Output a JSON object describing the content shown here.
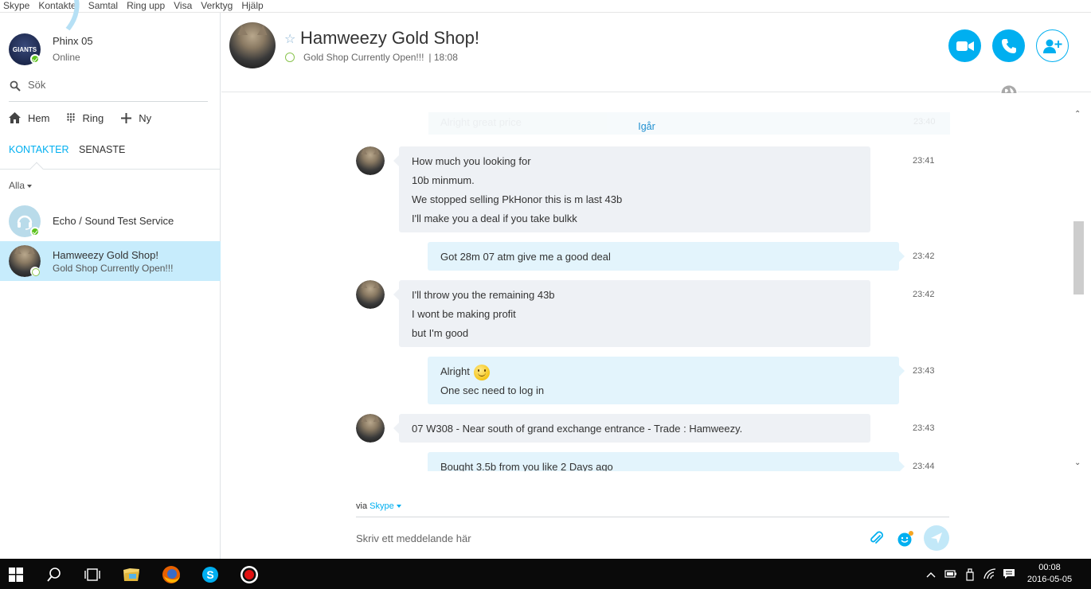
{
  "menu": [
    "Skype",
    "Kontakter",
    "Samtal",
    "Ring upp",
    "Visa",
    "Verktyg",
    "Hjälp"
  ],
  "me": {
    "name": "Phinx 05",
    "status": "Online",
    "avatar_text": "GIANTS"
  },
  "search": {
    "placeholder": "Sök"
  },
  "nav": {
    "home": "Hem",
    "call": "Ring",
    "new": "Ny"
  },
  "tabs": {
    "contacts": "KONTAKTER",
    "recent": "SENASTE"
  },
  "filter": "Alla",
  "contacts": [
    {
      "name": "Echo / Sound Test Service",
      "sub": ""
    },
    {
      "name": "Hamweezy Gold Shop!",
      "sub": "Gold Shop Currently Open!!!"
    }
  ],
  "conversation": {
    "title": "Hamweezy Gold Shop!",
    "mood": "Gold Shop Currently Open!!!",
    "local_time": "| 18:08"
  },
  "chat": {
    "ghost_text": "Alright great price",
    "ghost_time": "23:40",
    "day_label": "Igår",
    "messages": [
      {
        "dir": "in",
        "lines": [
          "How much you looking for",
          "10b minmum.",
          "We stopped selling PkHonor this is m last 43b",
          "I'll make you a deal if you take bulkk"
        ],
        "time": "23:41"
      },
      {
        "dir": "out",
        "lines": [
          "Got 28m 07 atm give me a good deal"
        ],
        "time": "23:42"
      },
      {
        "dir": "in",
        "lines": [
          "I'll throw you the remaining 43b",
          "I wont be making profit",
          "but I'm good"
        ],
        "time": "23:42"
      },
      {
        "dir": "out",
        "lines": [
          "Alright",
          "One sec need to log in"
        ],
        "time": "23:43"
      },
      {
        "dir": "in",
        "lines": [
          "07 W308 - Near south of grand exchange entrance - Trade : Hamweezy."
        ],
        "time": "23:43"
      },
      {
        "dir": "out",
        "lines": [
          "Bought 3.5b from you like 2 Days ago"
        ],
        "time": "23:44"
      }
    ]
  },
  "compose": {
    "via_label": "via",
    "via_service": "Skype",
    "placeholder": "Skriv ett meddelande här"
  },
  "taskbar": {
    "time": "00:08",
    "date": "2016-05-05"
  },
  "colors": {
    "accent": "#00aff0",
    "online": "#5dc21e",
    "selected": "#c7ecfc"
  }
}
